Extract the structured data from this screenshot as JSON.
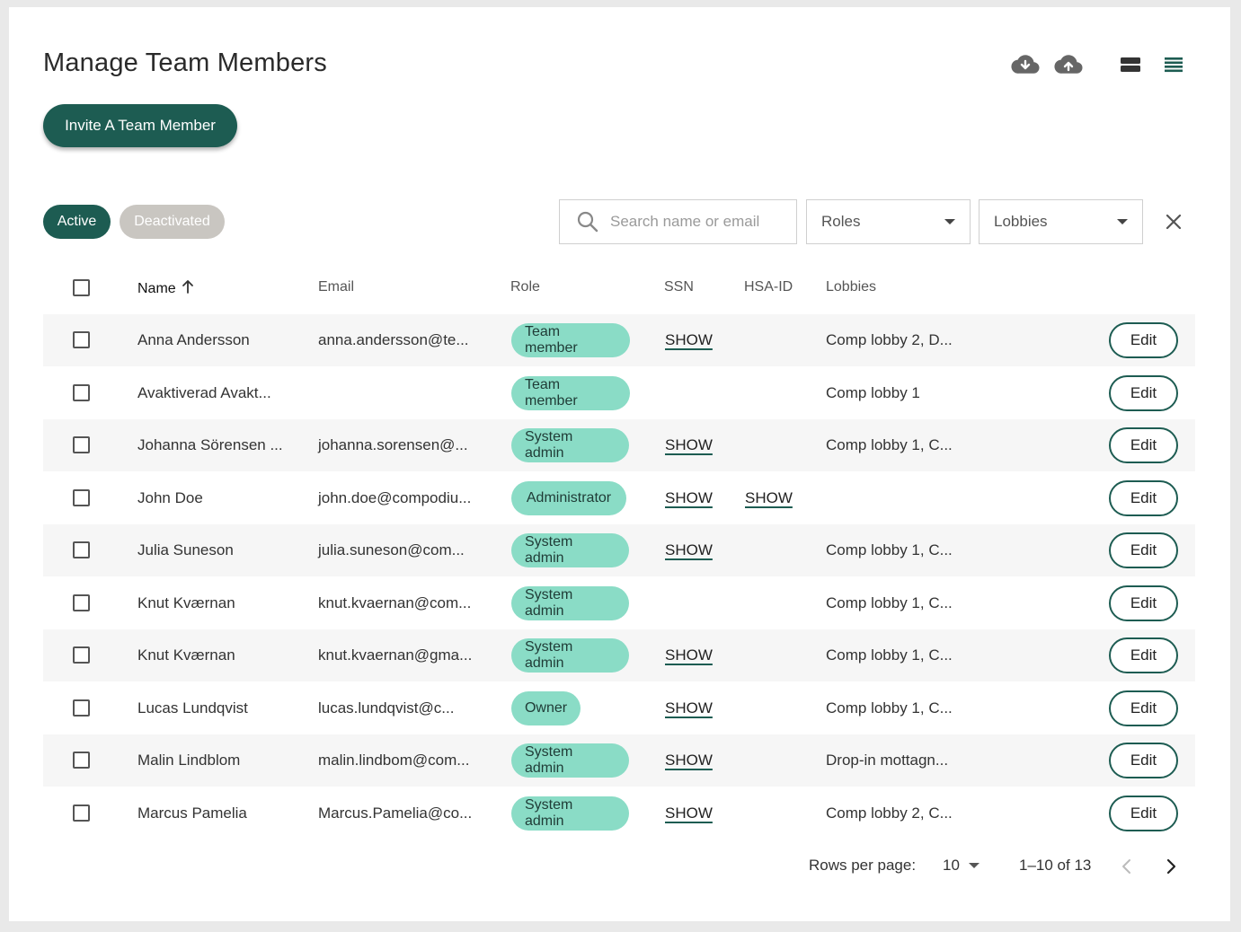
{
  "page": {
    "title": "Manage Team Members"
  },
  "actions": {
    "invite_label": "Invite A Team Member"
  },
  "status_filter": {
    "active_label": "Active",
    "deactivated_label": "Deactivated"
  },
  "search": {
    "placeholder": "Search name or email"
  },
  "filters": {
    "roles_label": "Roles",
    "lobbies_label": "Lobbies"
  },
  "columns": {
    "name": "Name",
    "email": "Email",
    "role": "Role",
    "ssn": "SSN",
    "hsa": "HSA-ID",
    "lobbies": "Lobbies"
  },
  "rows": [
    {
      "name": "Anna Andersson",
      "email": "anna.andersson@te...",
      "role": "Team member",
      "ssn": "SHOW",
      "hsa": "",
      "lobbies": "Comp lobby 2, D...",
      "edit": "Edit"
    },
    {
      "name": "Avaktiverad Avakt...",
      "email": "",
      "role": "Team member",
      "ssn": "",
      "hsa": "",
      "lobbies": "Comp lobby 1",
      "edit": "Edit"
    },
    {
      "name": "Johanna Sörensen ...",
      "email": "johanna.sorensen@...",
      "role": "System admin",
      "ssn": "SHOW",
      "hsa": "",
      "lobbies": "Comp lobby 1, C...",
      "edit": "Edit"
    },
    {
      "name": "John Doe",
      "email": "john.doe@compodiu...",
      "role": "Administrator",
      "ssn": "SHOW",
      "hsa": "SHOW",
      "lobbies": "",
      "edit": "Edit"
    },
    {
      "name": "Julia Suneson",
      "email": "julia.suneson@com...",
      "role": "System admin",
      "ssn": "SHOW",
      "hsa": "",
      "lobbies": "Comp lobby 1, C...",
      "edit": "Edit"
    },
    {
      "name": "Knut Kværnan",
      "email": "knut.kvaernan@com...",
      "role": "System admin",
      "ssn": "",
      "hsa": "",
      "lobbies": "Comp lobby 1, C...",
      "edit": "Edit"
    },
    {
      "name": "Knut Kværnan",
      "email": "knut.kvaernan@gma...",
      "role": "System admin",
      "ssn": "SHOW",
      "hsa": "",
      "lobbies": "Comp lobby 1, C...",
      "edit": "Edit"
    },
    {
      "name": "Lucas Lundqvist",
      "email": "lucas.lundqvist@c...",
      "role": "Owner",
      "ssn": "SHOW",
      "hsa": "",
      "lobbies": "Comp lobby 1, C...",
      "edit": "Edit"
    },
    {
      "name": "Malin Lindblom",
      "email": "malin.lindbom@com...",
      "role": "System admin",
      "ssn": "SHOW",
      "hsa": "",
      "lobbies": "Drop-in mottagn...",
      "edit": "Edit"
    },
    {
      "name": "Marcus Pamelia",
      "email": "Marcus.Pamelia@co...",
      "role": "System admin",
      "ssn": "SHOW",
      "hsa": "",
      "lobbies": "Comp lobby 2, C...",
      "edit": "Edit"
    }
  ],
  "pagination": {
    "rows_per_page_label": "Rows per page:",
    "rows_per_page_value": "10",
    "range": "1–10 of 13"
  },
  "icons": [
    "cloud-download-icon",
    "cloud-upload-icon",
    "compact-view-icon",
    "list-view-icon",
    "search-icon",
    "close-icon",
    "sort-arrow-up-icon",
    "chevron-left-icon",
    "chevron-right-icon"
  ],
  "colors": {
    "primary": "#1d5c52",
    "role_chip": "#8adcc6",
    "deactivated_chip": "#c9c6c1",
    "row_alt": "#f6f6f6"
  }
}
